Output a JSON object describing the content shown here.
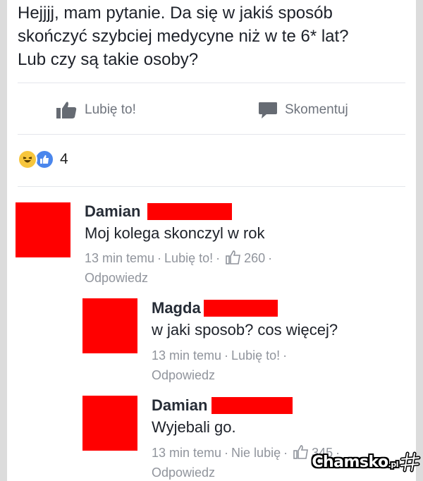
{
  "post": {
    "text": "Hejjjj, mam pytanie. Da się w jakiś sposób\nskończyć szybciej medycyne niż w te 6* lat?\nLub czy są takie osoby?"
  },
  "actions": {
    "like_label": "Lubię to!",
    "comment_label": "Skomentuj"
  },
  "reactions": {
    "count": "4",
    "icons": [
      "haha-icon",
      "like-icon"
    ]
  },
  "comments": [
    {
      "name": "Damian",
      "text": "Moj kolega skonczyl w rok",
      "time": "13 min temu",
      "like": "Lubię to!",
      "likes": "260",
      "reply": "Odpowiedz"
    },
    {
      "name": "Magda",
      "text": "w jaki sposob? cos więcej?",
      "time": "13 min temu",
      "like": "Lubię to!",
      "reply": "Odpowiedz"
    },
    {
      "name": "Damian",
      "text": "Wyjebali go.",
      "time": "13 min temu",
      "like": "Nie lubię",
      "likes": "345",
      "reply": "Odpowiedz"
    }
  ],
  "watermark": {
    "brand": "Chamsko",
    "tld": ".pl"
  },
  "colors": {
    "redaction": "#ff0000",
    "like_blue": "#4a86ec",
    "meta_grey": "#90949c"
  }
}
